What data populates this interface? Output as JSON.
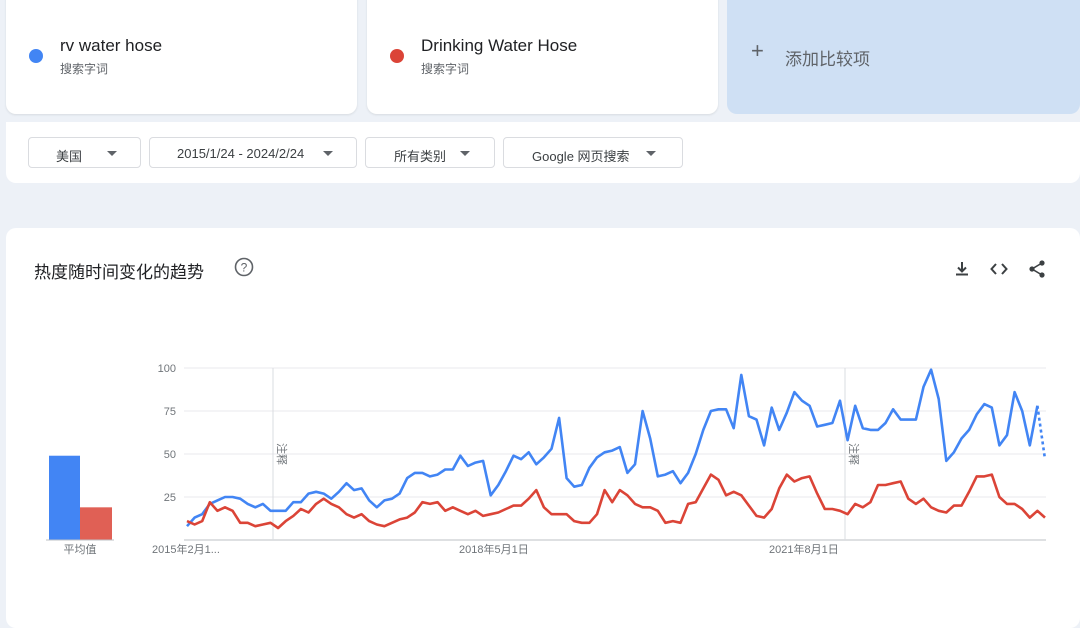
{
  "terms": [
    {
      "name": "rv water hose",
      "sub": "搜索字词",
      "color": "#4285f4"
    },
    {
      "name": "Drinking Water Hose",
      "sub": "搜索字词",
      "color": "#db4437"
    }
  ],
  "add_compare": {
    "icon": "+",
    "label": "添加比较项"
  },
  "filters": {
    "region": "美国",
    "date_range": "2015/1/24 - 2024/2/24",
    "category": "所有类别",
    "search_type": "Google 网页搜索"
  },
  "chart_panel": {
    "title": "热度随时间变化的趋势",
    "help_icon": "help-circle-icon",
    "tools": [
      "download-icon",
      "embed-code-icon",
      "share-icon"
    ]
  },
  "chart_data": {
    "type": "line",
    "yticks": [
      25,
      50,
      75,
      100
    ],
    "ylim": [
      0,
      100
    ],
    "xtick_labels": [
      "2015年2月1...",
      "2018年5月1日",
      "2021年8月1日"
    ],
    "note_label": "注释",
    "average_label": "平均值",
    "averages": [
      {
        "series": "rv water hose",
        "value": 49
      },
      {
        "series": "Drinking Water Hose",
        "value": 19
      }
    ],
    "series": [
      {
        "name": "rv water hose",
        "color": "#4285f4",
        "values": [
          8,
          13,
          15,
          21,
          23,
          25,
          25,
          24,
          21,
          19,
          21,
          17,
          17,
          17,
          22,
          22,
          27,
          28,
          27,
          24,
          28,
          33,
          29,
          30,
          23,
          19,
          23,
          24,
          27,
          36,
          39,
          39,
          37,
          38,
          41,
          41,
          49,
          43,
          45,
          46,
          26,
          32,
          40,
          49,
          47,
          51,
          44,
          48,
          53,
          71,
          36,
          31,
          32,
          42,
          48,
          51,
          52,
          54,
          39,
          44,
          75,
          59,
          37,
          38,
          40,
          33,
          39,
          50,
          64,
          75,
          76,
          76,
          65,
          96,
          72,
          70,
          55,
          77,
          64,
          74,
          86,
          81,
          78,
          66,
          67,
          68,
          81,
          58,
          78,
          65,
          64,
          64,
          68,
          76,
          70,
          70,
          70,
          89,
          99,
          82,
          46,
          51,
          59,
          64,
          73,
          79,
          77,
          55,
          61,
          86,
          75,
          55,
          78,
          47
        ]
      },
      {
        "name": "Drinking Water Hose",
        "color": "#db4437",
        "values": [
          11,
          9,
          11,
          22,
          17,
          19,
          17,
          10,
          10,
          8,
          9,
          10,
          7,
          11,
          14,
          18,
          16,
          21,
          24,
          21,
          19,
          15,
          13,
          15,
          11,
          9,
          8,
          10,
          12,
          13,
          16,
          22,
          21,
          22,
          17,
          19,
          17,
          15,
          17,
          14,
          15,
          16,
          18,
          20,
          20,
          24,
          29,
          19,
          15,
          15,
          15,
          11,
          10,
          10,
          15,
          29,
          22,
          29,
          26,
          21,
          19,
          19,
          17,
          10,
          11,
          10,
          21,
          22,
          30,
          38,
          35,
          26,
          28,
          26,
          20,
          14,
          13,
          18,
          30,
          38,
          34,
          36,
          37,
          27,
          18,
          18,
          17,
          15,
          21,
          19,
          22,
          32,
          32,
          33,
          34,
          24,
          21,
          24,
          19,
          17,
          16,
          20,
          20,
          28,
          37,
          37,
          38,
          25,
          21,
          21,
          18,
          13,
          17,
          13
        ]
      }
    ]
  }
}
